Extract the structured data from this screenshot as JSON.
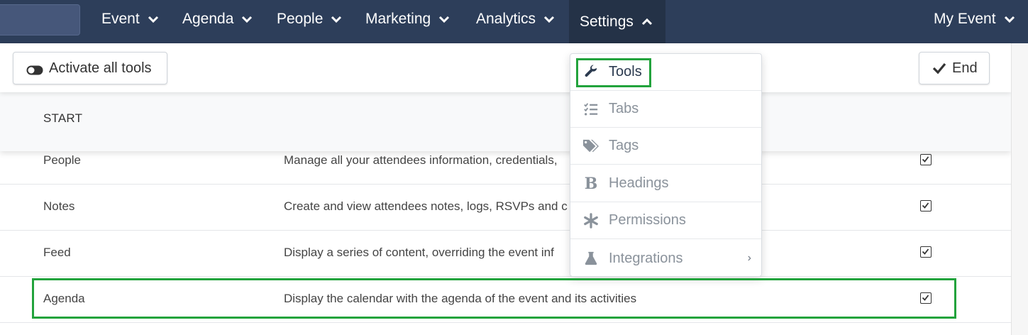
{
  "nav": {
    "items": [
      {
        "label": "Event"
      },
      {
        "label": "Agenda"
      },
      {
        "label": "People"
      },
      {
        "label": "Marketing"
      },
      {
        "label": "Analytics"
      },
      {
        "label": "Settings"
      }
    ],
    "account_label": "My Event"
  },
  "toolbar": {
    "activate_label": "Activate all tools",
    "end_label": "End"
  },
  "table": {
    "header": "START",
    "rows": [
      {
        "name": "People",
        "description": "Manage all your attendees information, credentials,",
        "checked": true
      },
      {
        "name": "Notes",
        "description": "Create and view attendees notes, logs, RSVPs and c",
        "checked": true
      },
      {
        "name": "Feed",
        "description": "Display a series of content, overriding the event inf",
        "checked": true
      },
      {
        "name": "Agenda",
        "description": "Display the calendar with the agenda of the event and its activities",
        "checked": true
      }
    ]
  },
  "settings_menu": {
    "items": [
      {
        "label": "Tools",
        "icon": "wrench-icon"
      },
      {
        "label": "Tabs",
        "icon": "list-check-icon"
      },
      {
        "label": "Tags",
        "icon": "tags-icon"
      },
      {
        "label": "Headings",
        "icon": "bold-icon"
      },
      {
        "label": "Permissions",
        "icon": "asterisk-icon"
      },
      {
        "label": "Integrations",
        "icon": "flask-icon"
      }
    ]
  },
  "colors": {
    "nav_bg": "#2d3e5a",
    "highlight": "#22a33c"
  }
}
